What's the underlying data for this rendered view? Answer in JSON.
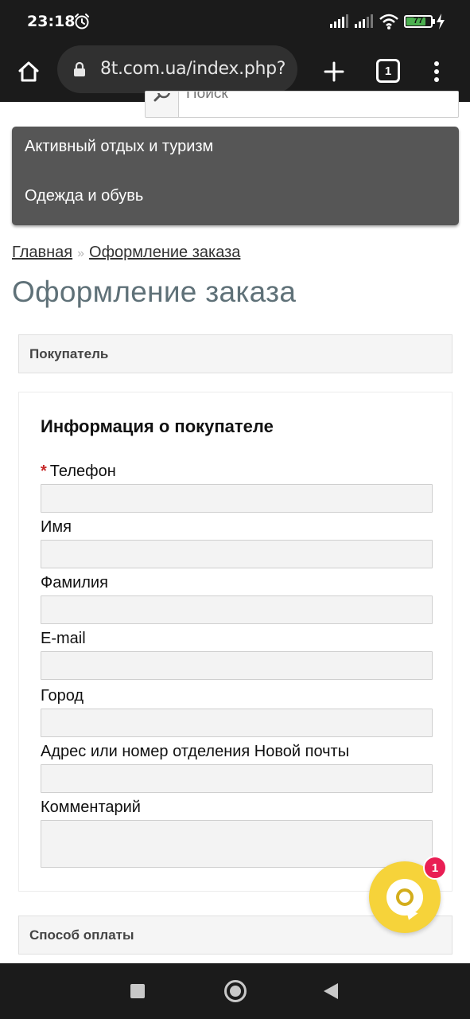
{
  "status_bar": {
    "time": "23:18",
    "battery_percent": "77",
    "icons": [
      "alarm-icon",
      "signal-icon",
      "signal-icon",
      "wifi-icon",
      "battery-icon",
      "charging-icon"
    ]
  },
  "browser": {
    "url": "8t.com.ua/index.php?",
    "tab_count": "1",
    "icons": [
      "home-icon",
      "lock-icon",
      "plus-icon",
      "tab-count-icon",
      "more-vert-icon"
    ]
  },
  "search": {
    "placeholder": "Поиск"
  },
  "categories": [
    {
      "label": "Активный отдых и туризм"
    },
    {
      "label": "Одежда и обувь"
    }
  ],
  "breadcrumb": {
    "home": "Главная",
    "separator": "»",
    "current": "Оформление заказа"
  },
  "page_title": "Оформление заказа",
  "sections": {
    "buyer": "Покупатель",
    "payment": "Способ оплаты"
  },
  "form": {
    "heading": "Информация о покупателе",
    "required_mark": "*",
    "fields": [
      {
        "label": "Телефон",
        "value": ""
      },
      {
        "label": "Имя",
        "value": ""
      },
      {
        "label": "Фамилия",
        "value": ""
      },
      {
        "label": "E-mail",
        "value": ""
      },
      {
        "label": "Город",
        "value": ""
      },
      {
        "label": "Адрес или номер отделения Новой почты",
        "value": ""
      },
      {
        "label": "Комментарий",
        "value": ""
      }
    ]
  },
  "chat": {
    "badge_count": "1",
    "accent": "#f6d33a",
    "badge_color": "#e91e54"
  },
  "nav_bar": {
    "icons": [
      "recents-icon",
      "home-circle-icon",
      "back-icon"
    ]
  }
}
